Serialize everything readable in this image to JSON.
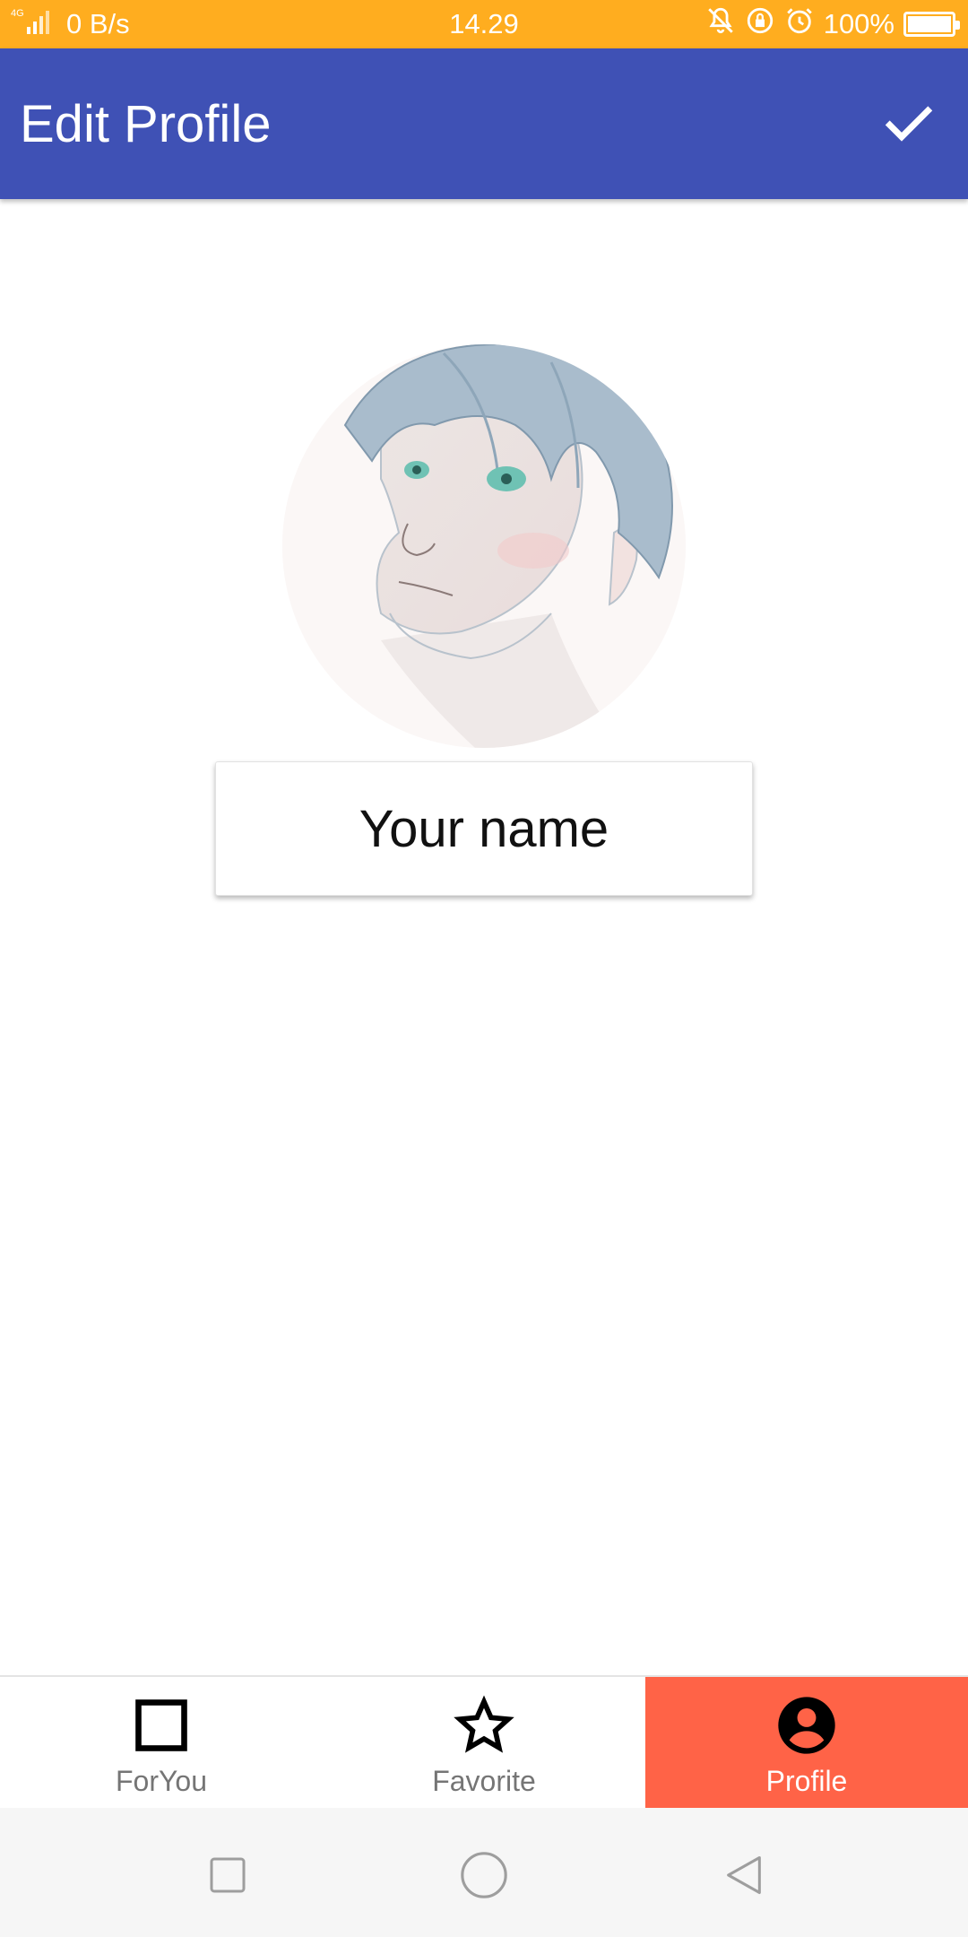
{
  "status_bar": {
    "network": "4G",
    "speed": "0 B/s",
    "time": "14.29",
    "battery": "100%"
  },
  "app_bar": {
    "title": "Edit Profile",
    "confirm_icon": "check-icon"
  },
  "profile": {
    "avatar_alt": "profile-avatar-illustration",
    "name_placeholder": "Your name"
  },
  "bottom_nav": {
    "items": [
      {
        "label": "ForYou",
        "icon": "square-icon",
        "active": false
      },
      {
        "label": "Favorite",
        "icon": "star-icon",
        "active": false
      },
      {
        "label": "Profile",
        "icon": "account-circle-icon",
        "active": true
      }
    ]
  },
  "colors": {
    "status_bar": "#FFAD1F",
    "app_bar": "#3F51B5",
    "active_tab": "#FF6347"
  }
}
